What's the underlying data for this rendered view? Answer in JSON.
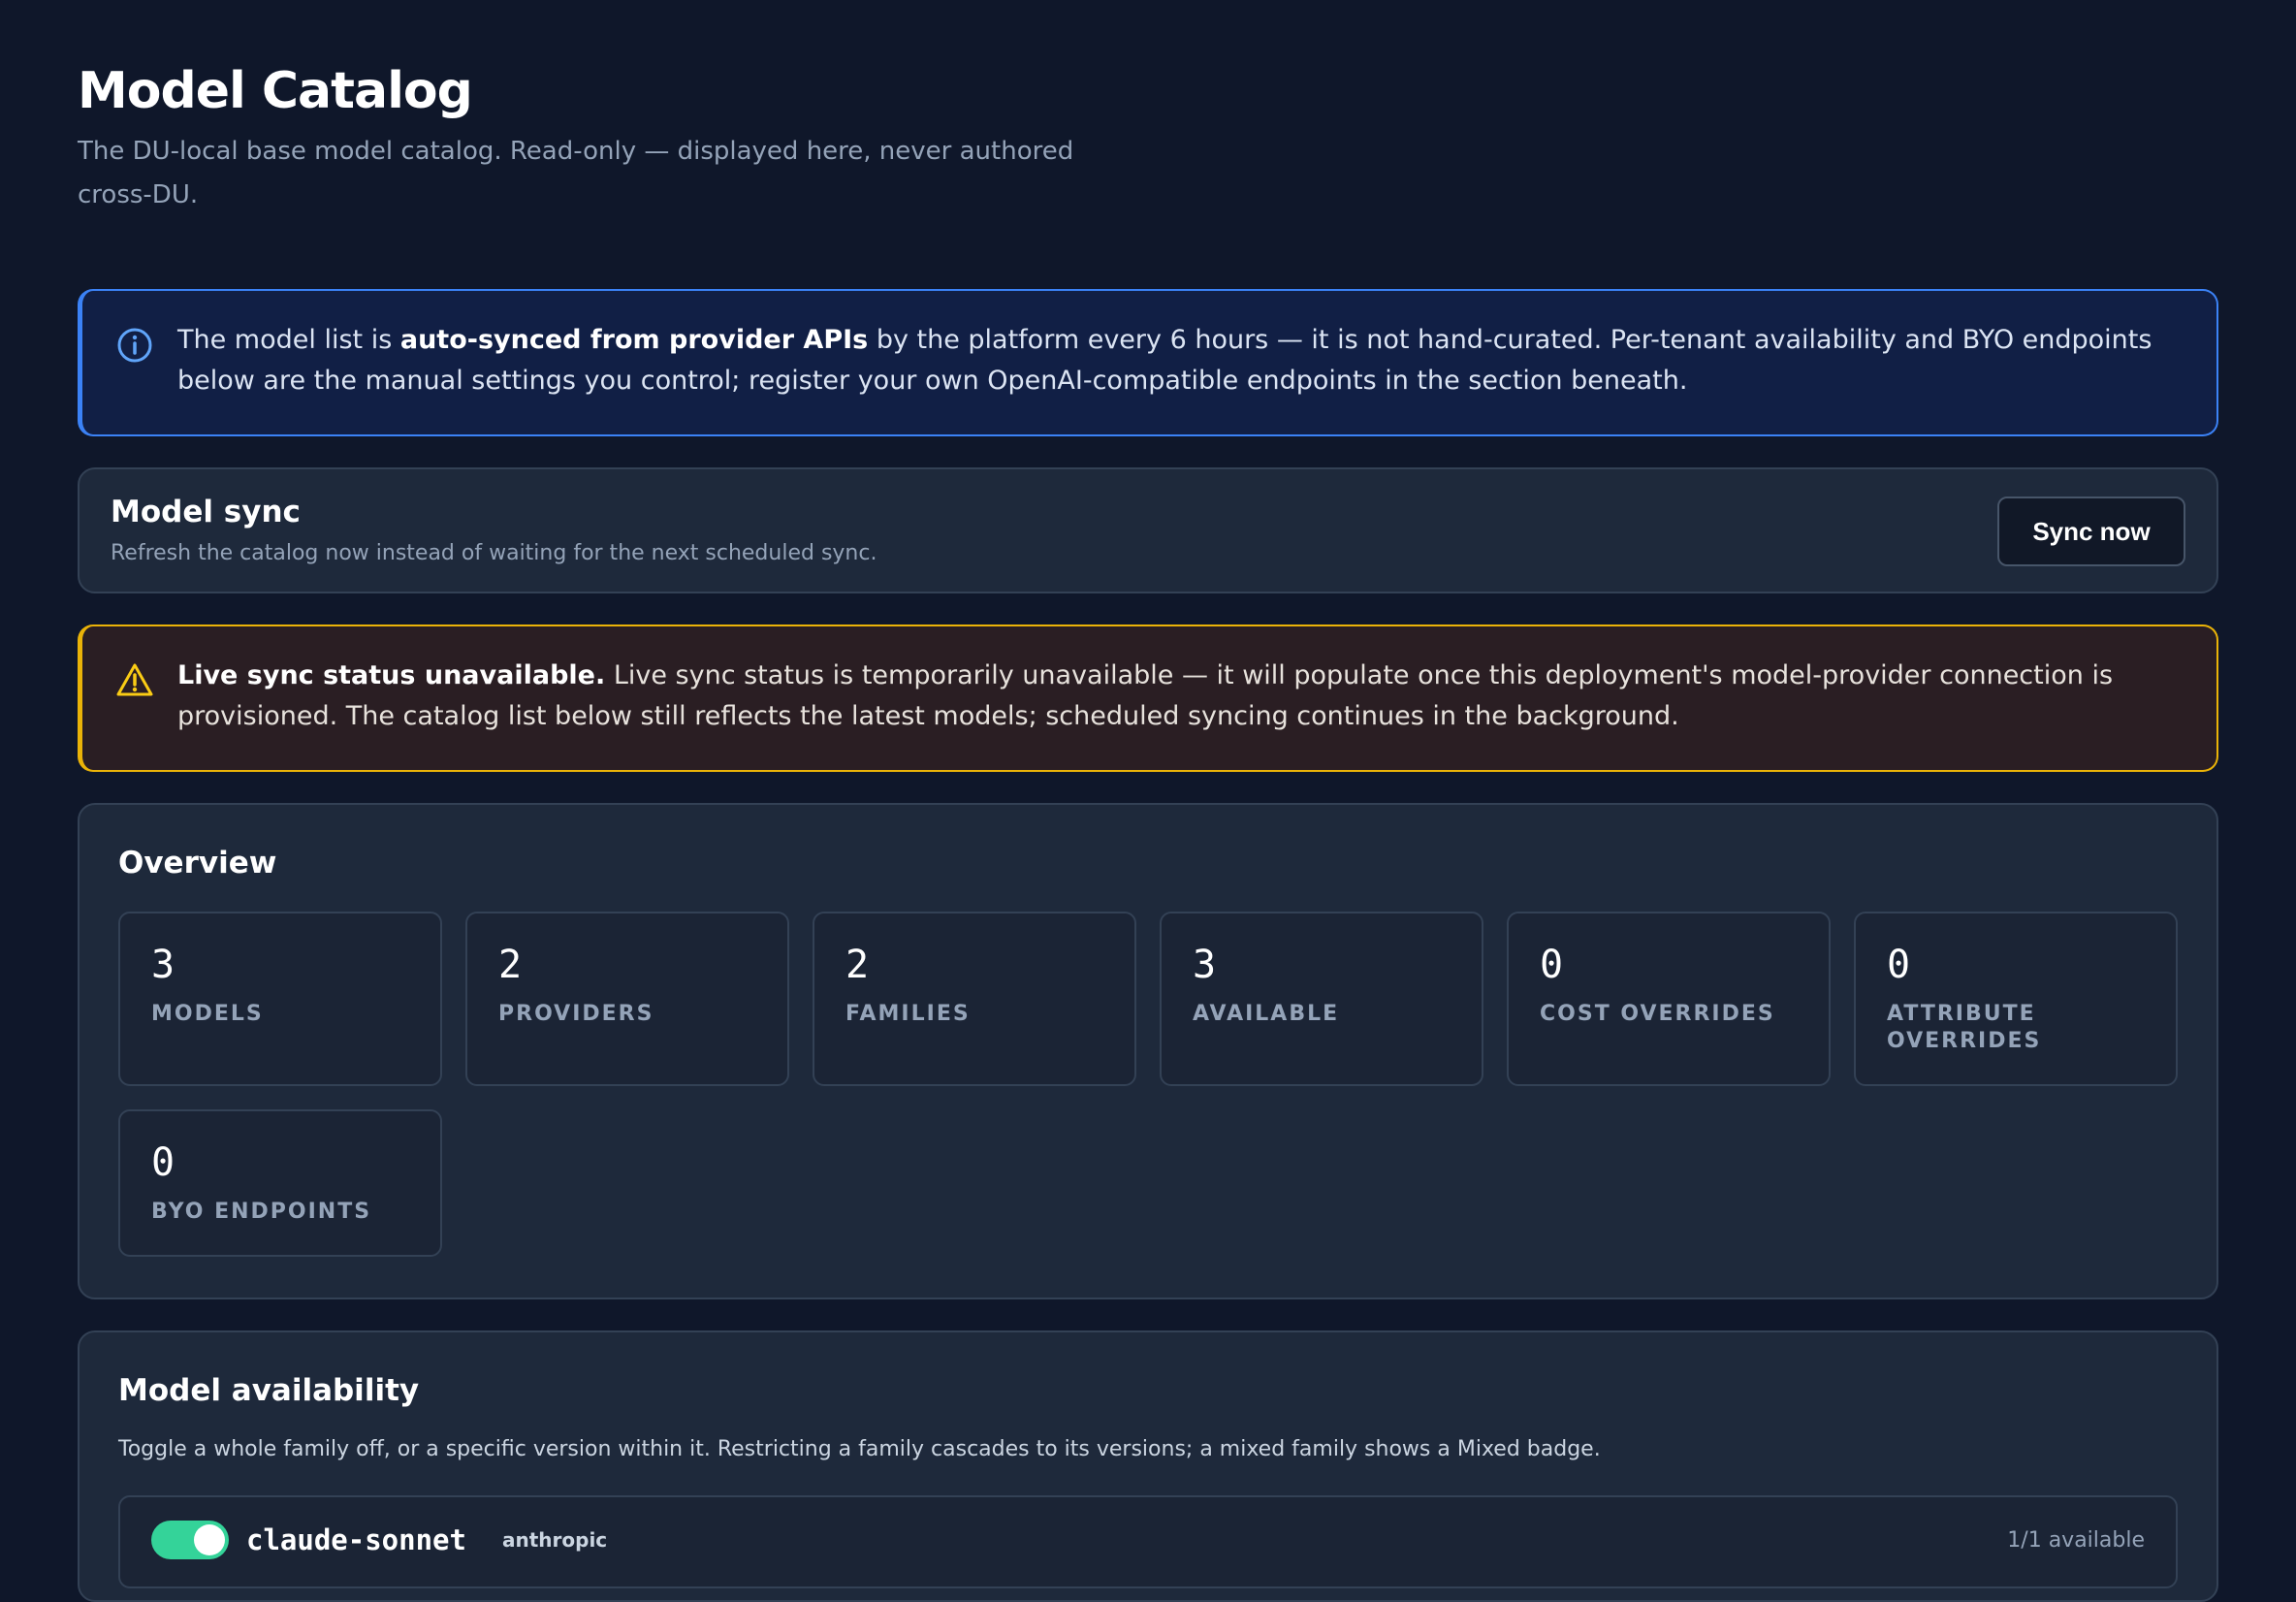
{
  "header": {
    "title": "Model Catalog",
    "subtitle": "The DU-local base model catalog. Read-only — displayed here, never authored cross-DU."
  },
  "info_banner": {
    "icon": "info-icon",
    "color": "#3b82f6",
    "text_before": "The model list is ",
    "bold": "auto-synced from provider APIs",
    "text_after": " by the platform every 6 hours — it is not hand-curated. Per-tenant availability and BYO endpoints below are the manual settings you control; register your own OpenAI-compatible endpoints in the section beneath."
  },
  "sync": {
    "title": "Model sync",
    "description": "Refresh the catalog now instead of waiting for the next scheduled sync.",
    "button_label": "Sync now"
  },
  "warning_banner": {
    "icon": "warning-icon",
    "color": "#eab308",
    "bold": "Live sync status unavailable.",
    "text": " Live sync status is temporarily unavailable — it will populate once this deployment's model-provider connection is provisioned. The catalog list below still reflects the latest models; scheduled syncing continues in the background."
  },
  "overview": {
    "title": "Overview",
    "stats": [
      {
        "value": "3",
        "label": "Models"
      },
      {
        "value": "2",
        "label": "Providers"
      },
      {
        "value": "2",
        "label": "Families"
      },
      {
        "value": "3",
        "label": "Available"
      },
      {
        "value": "0",
        "label": "Cost overrides"
      },
      {
        "value": "0",
        "label": "Attribute overrides"
      },
      {
        "value": "0",
        "label": "BYO endpoints"
      }
    ]
  },
  "availability": {
    "title": "Model availability",
    "description": "Toggle a whole family off, or a specific version within it. Restricting a family cascades to its versions; a mixed family shows a Mixed badge.",
    "models": [
      {
        "family": "claude-sonnet",
        "provider": "anthropic",
        "availability": "1/1 available",
        "enabled": true
      }
    ]
  },
  "colors": {
    "background": "#0f172a",
    "panel": "#1e293b",
    "accent_info": "#3b82f6",
    "accent_warning": "#eab308",
    "toggle_on": "#34d399"
  }
}
